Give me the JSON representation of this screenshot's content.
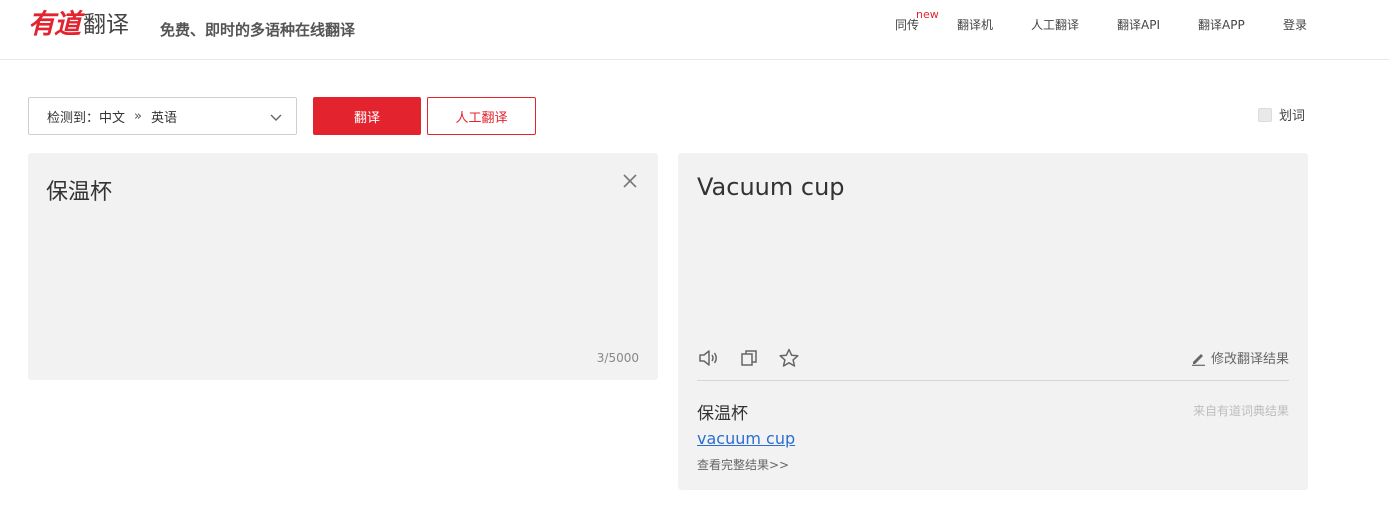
{
  "header": {
    "logo_red": "有道",
    "logo_gray": "翻译",
    "slogan": "免费、即时的多语种在线翻译",
    "nav": [
      {
        "label": "同传",
        "badge": "new"
      },
      {
        "label": "翻译机"
      },
      {
        "label": "人工翻译"
      },
      {
        "label": "翻译API"
      },
      {
        "label": "翻译APP"
      },
      {
        "label": "登录"
      }
    ]
  },
  "toolbar": {
    "lang_detected": "检测到：中文",
    "lang_arrow": "»",
    "lang_target": "英语",
    "translate_label": "翻译",
    "human_label": "人工翻译",
    "huaci_label": "划词",
    "huaci_checked": false
  },
  "input": {
    "text": "保温杯",
    "counter": "3/5000"
  },
  "output": {
    "text": "Vacuum cup",
    "edit_label": "修改翻译结果",
    "dict": {
      "word": "保温杯",
      "source": "来自有道词典结果",
      "link": "vacuum cup",
      "more": "查看完整结果>>"
    }
  },
  "colors": {
    "brand_red": "#e3242f",
    "panel_bg": "#f2f2f2",
    "link_blue": "#2b6fd1"
  },
  "icons": {
    "clear": "close-icon",
    "speaker": "speaker-icon",
    "copy": "copy-icon",
    "star": "star-icon",
    "edit": "pencil-icon",
    "dropdown": "chevron-down-icon"
  }
}
